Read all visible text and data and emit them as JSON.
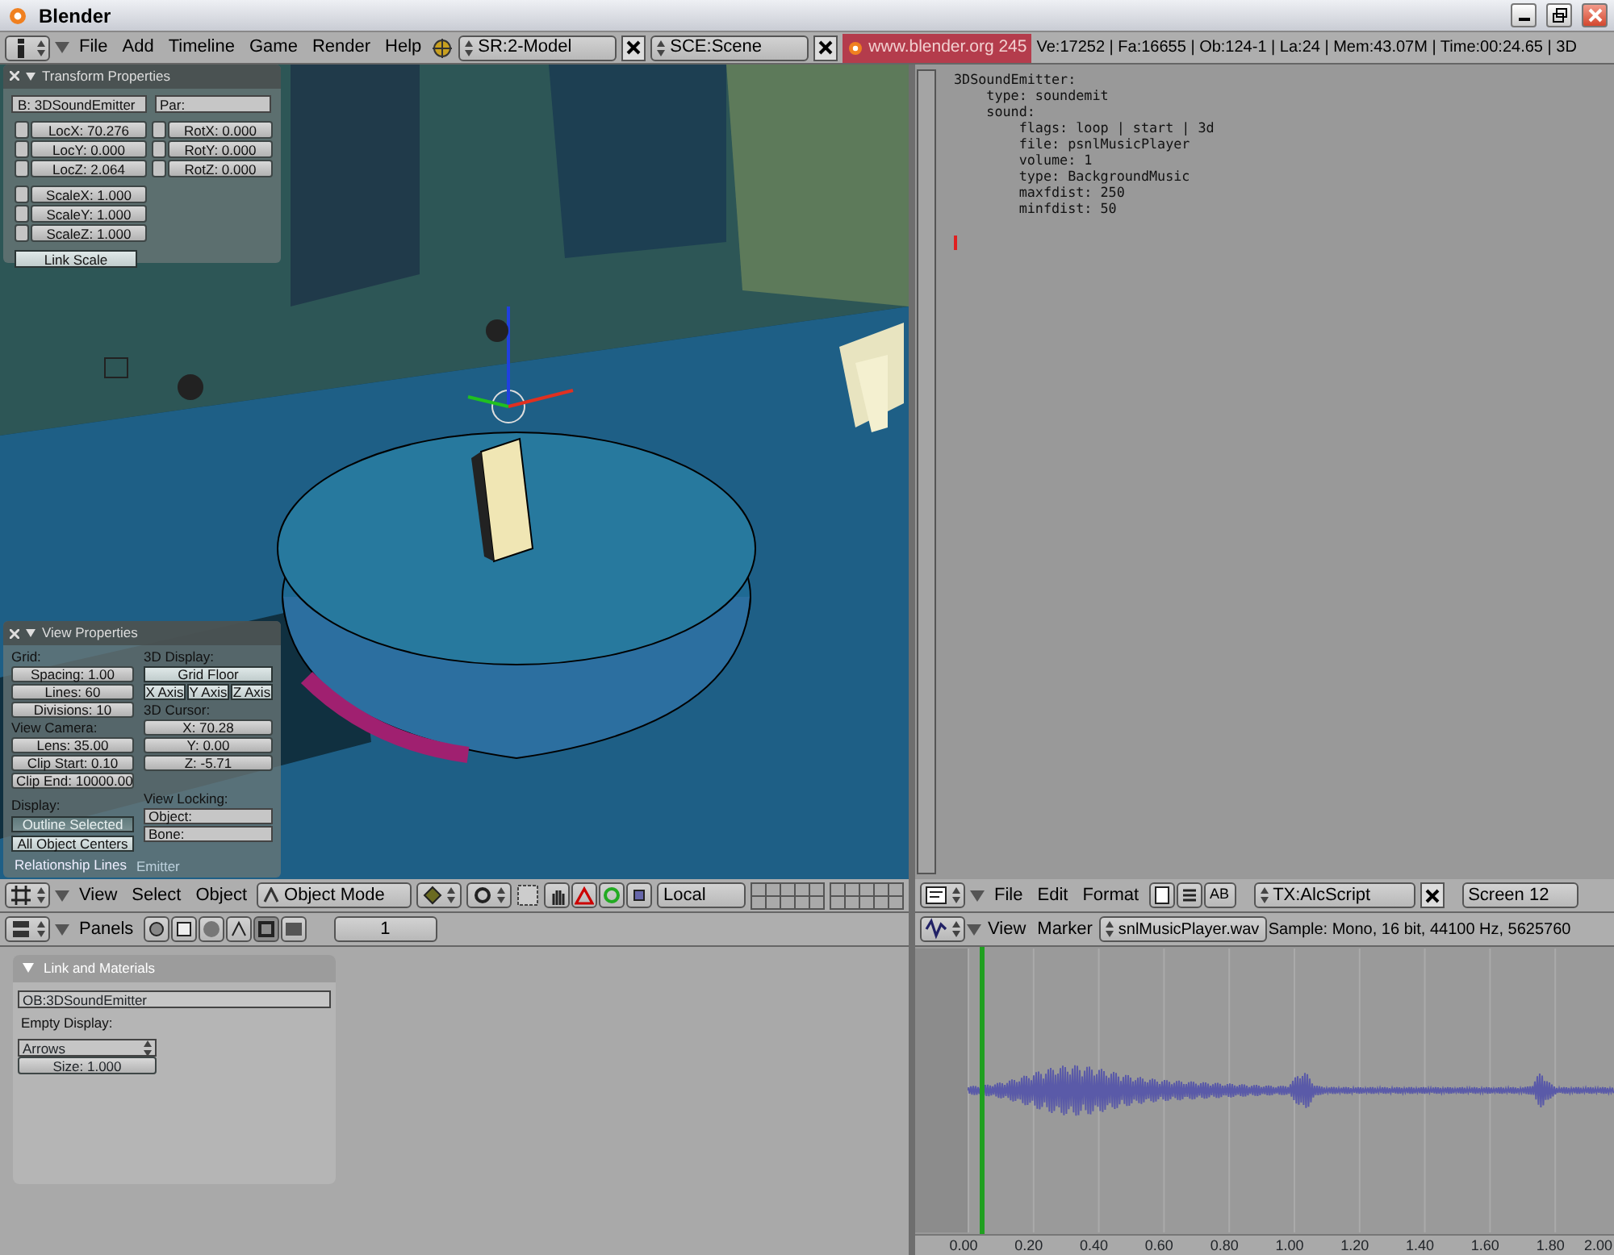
{
  "window": {
    "title": "Blender"
  },
  "info_header": {
    "menus": [
      "File",
      "Add",
      "Timeline",
      "Game",
      "Render",
      "Help"
    ],
    "screen": "SR:2-Model",
    "scene": "SCE:Scene",
    "url": "www.blender.org 245",
    "stats": "Ve:17252 | Fa:16655 | Ob:124-1 | La:24  | Mem:43.07M | Time:00:24.65 | 3D"
  },
  "transform_panel": {
    "title": "Transform Properties",
    "object_name": "B: 3DSoundEmitter",
    "parent": "Par:",
    "location": [
      "LocX: 70.276",
      "LocY: 0.000",
      "LocZ: 2.064"
    ],
    "rotation": [
      "RotX: 0.000",
      "RotY: 0.000",
      "RotZ: 0.000"
    ],
    "scale": [
      "ScaleX: 1.000",
      "ScaleY: 1.000",
      "ScaleZ: 1.000"
    ],
    "link_scale": "Link Scale"
  },
  "view_panel": {
    "title": "View Properties",
    "grid_label": "Grid:",
    "grid": [
      "Spacing: 1.00",
      "Lines: 60",
      "Divisions: 10"
    ],
    "display_3d_label": "3D Display:",
    "grid_floor": "Grid Floor",
    "axes": [
      "X Axis",
      "Y Axis",
      "Z Axis"
    ],
    "camera_label": "View Camera:",
    "camera": [
      "Lens: 35.00",
      "Clip Start: 0.10",
      "Clip End: 10000.00"
    ],
    "cursor_label": "3D Cursor:",
    "cursor": [
      "X: 70.28",
      "Y: 0.00",
      "Z: -5.71"
    ],
    "display_label": "Display:",
    "display": [
      {
        "label": "Outline Selected",
        "on": true
      },
      {
        "label": "All Object Centers",
        "on": false
      },
      {
        "label": "Relationship Lines",
        "on": true
      }
    ],
    "locking_label": "View Locking:",
    "locking": [
      "Object:",
      "Bone:"
    ]
  },
  "viewport_label": "Emitter",
  "view3d_header": {
    "menus": [
      "View",
      "Select",
      "Object"
    ],
    "mode": "Object Mode",
    "orientation": "Local"
  },
  "buttons_header": {
    "label": "Panels",
    "frame": "1"
  },
  "link_panel": {
    "title": "Link and Materials",
    "object": "OB:3DSoundEmitter",
    "empty_display_label": "Empty Display:",
    "empty_display": "Arrows",
    "size": "Size: 1.000"
  },
  "text_editor": {
    "lines": [
      "3DSoundEmitter:",
      "    type: soundemit",
      "    sound:",
      "        flags: loop | start | 3d",
      "        file: psnlMusicPlayer",
      "        volume: 1",
      "        type: BackgroundMusic",
      "        maxfdist: 250",
      "        minfdist: 50"
    ]
  },
  "text_header": {
    "menus": [
      "File",
      "Edit",
      "Format"
    ],
    "syntax_button": "AB",
    "text": "TX:AlcScript",
    "font": "Screen 12"
  },
  "sound_header": {
    "menus": [
      "View",
      "Marker"
    ],
    "sound": "snlMusicPlayer.wav",
    "info": "Sample: Mono, 16 bit, 44100 Hz, 5625760"
  },
  "sound_ruler": [
    "0.00",
    "0.20",
    "0.40",
    "0.60",
    "0.80",
    "1.00",
    "1.20",
    "1.40",
    "1.60",
    "1.80",
    "2.00"
  ]
}
